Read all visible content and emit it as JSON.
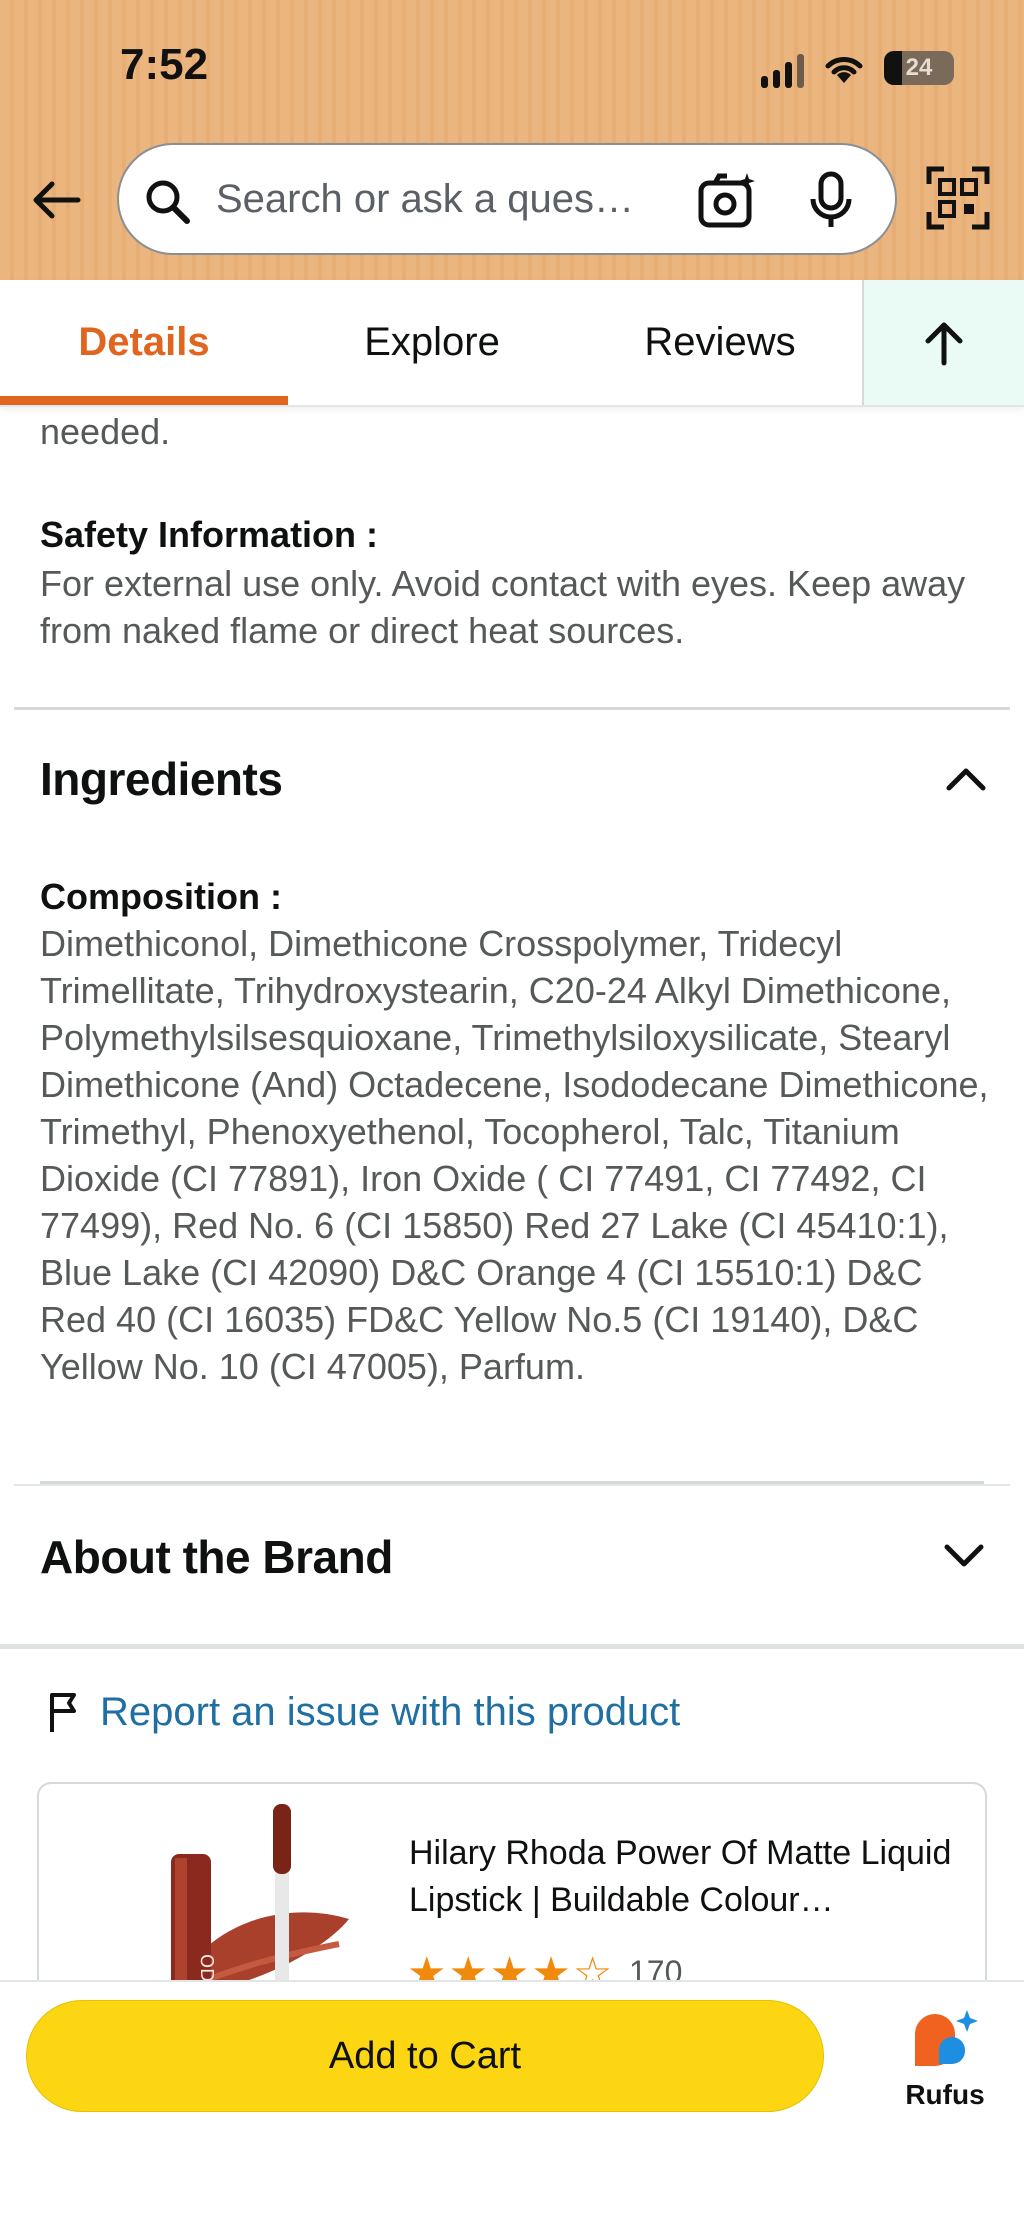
{
  "status_bar": {
    "time": "7:52",
    "battery": "24"
  },
  "search": {
    "placeholder": "Search or ask a ques…"
  },
  "tabs": [
    {
      "label": "Details",
      "active": true
    },
    {
      "label": "Explore"
    },
    {
      "label": "Reviews"
    }
  ],
  "details": {
    "continued_text": "needed.",
    "safety_label": "Safety Information :",
    "safety_text": "For external use only. Avoid contact with eyes. Keep away from naked flame or direct heat sources."
  },
  "ingredients": {
    "title": "Ingredients",
    "composition_label": "Composition :",
    "composition_text": "Dimethiconol, Dimethicone Crosspolymer, Tridecyl Trimellitate, Trihydroxystearin, C20-24 Alkyl Dimethicone, Polymethylsilsesquioxane, Trimethylsiloxysilicate, Stearyl Dimethicone (And) Octadecene, Isododecane Dimethicone, Trimethyl, Phenoxyethenol, Tocopherol, Talc, Titanium Dioxide (CI 77891), Iron Oxide ( CI 77491, CI 77492, CI 77499), Red No. 6 (CI 15850) Red 27 Lake (CI 45410:1), Blue Lake (CI 42090) D&C Orange 4 (CI 15510:1) D&C Red 40 (CI 16035) FD&C Yellow No.5 (CI 19140), D&C Yellow No. 10 (CI 47005), Parfum."
  },
  "about_brand": {
    "title": "About the Brand"
  },
  "report": {
    "label": "Report an issue with this product"
  },
  "product_card": {
    "title": "Hilary Rhoda Power Of Matte Liquid Lipstick | Buildable Colour…",
    "rating": 4,
    "rating_count": "170",
    "image_brand_text": "ODA"
  },
  "bottom_bar": {
    "add_to_cart": "Add to Cart",
    "rufus_label": "Rufus"
  },
  "colors": {
    "accent": "#e0661f",
    "header": "#ebb57f",
    "cart": "#fcd513",
    "link": "#1f6fa3"
  }
}
